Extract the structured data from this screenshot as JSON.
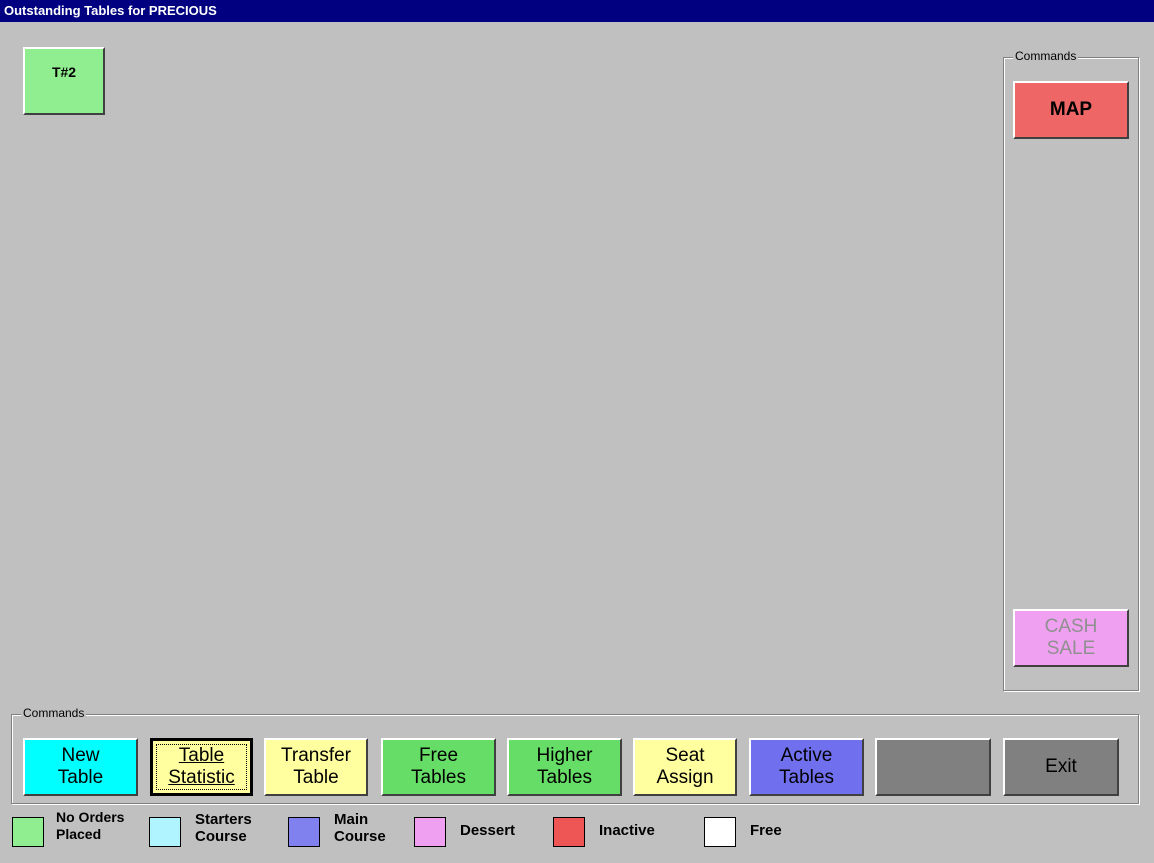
{
  "window": {
    "title": "Outstanding Tables for PRECIOUS"
  },
  "tables": [
    {
      "label": "T#2",
      "color": "#90ee90"
    }
  ],
  "right_commands": {
    "label": "Commands",
    "map_label": "MAP",
    "cash_sale_label": "CASH\nSALE"
  },
  "bottom_commands": {
    "label": "Commands",
    "buttons": [
      {
        "label": "New\nTable",
        "color": "#00ffff"
      },
      {
        "label": "Table\nStatistic",
        "color": "#ffffa0"
      },
      {
        "label": "Transfer\nTable",
        "color": "#ffffa0"
      },
      {
        "label": "Free\nTables",
        "color": "#66dd66"
      },
      {
        "label": "Higher\nTables",
        "color": "#66dd66"
      },
      {
        "label": "Seat\nAssign",
        "color": "#ffffa0"
      },
      {
        "label": "Active\nTables",
        "color": "#7070ee"
      },
      {
        "label": "",
        "color": "#808080"
      },
      {
        "label": "Exit",
        "color": "#808080"
      }
    ]
  },
  "legend": [
    {
      "label": "No Orders\nPlaced",
      "color": "#90ee90"
    },
    {
      "label": "Starters\nCourse",
      "color": "#b0f4ff"
    },
    {
      "label": "Main\nCourse",
      "color": "#8080ee"
    },
    {
      "label": "Dessert",
      "color": "#f0a0f0"
    },
    {
      "label": "Inactive",
      "color": "#ee5555"
    },
    {
      "label": "Free",
      "color": "#ffffff"
    }
  ]
}
